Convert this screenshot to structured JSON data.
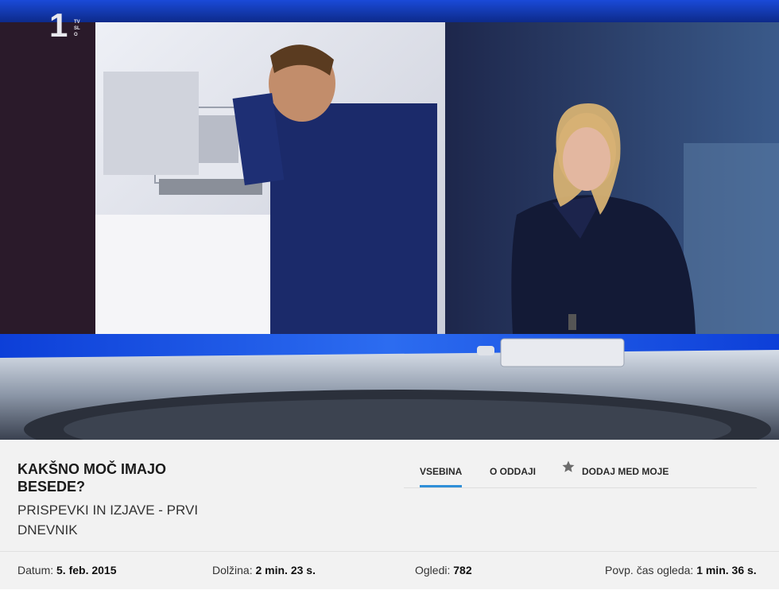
{
  "video": {
    "channel_logo": "1",
    "channel_sub": "TV SLO"
  },
  "episode": {
    "title": "KAKŠNO MOČ IMAJO BESEDE?",
    "subtitle": "PRISPEVKI IN IZJAVE - PRVI DNEVNIK"
  },
  "tabs": [
    {
      "label": "VSEBINA",
      "active": true
    },
    {
      "label": "O ODDAJI",
      "active": false
    },
    {
      "label": "DODAJ MED MOJE",
      "icon": "star-icon",
      "active": false
    }
  ],
  "stats": {
    "date_label": "Datum:",
    "date_value": "5. feb. 2015",
    "duration_label": "Dolžina:",
    "duration_value": "2 min. 23 s.",
    "views_label": "Ogledi:",
    "views_value": "782",
    "avg_label": "Povp. čas ogleda:",
    "avg_value": "1 min. 36 s."
  },
  "colors": {
    "accent": "#2f8fd8",
    "panel_bg": "#f2f2f2",
    "studio_blue": "#1f4fd6"
  }
}
